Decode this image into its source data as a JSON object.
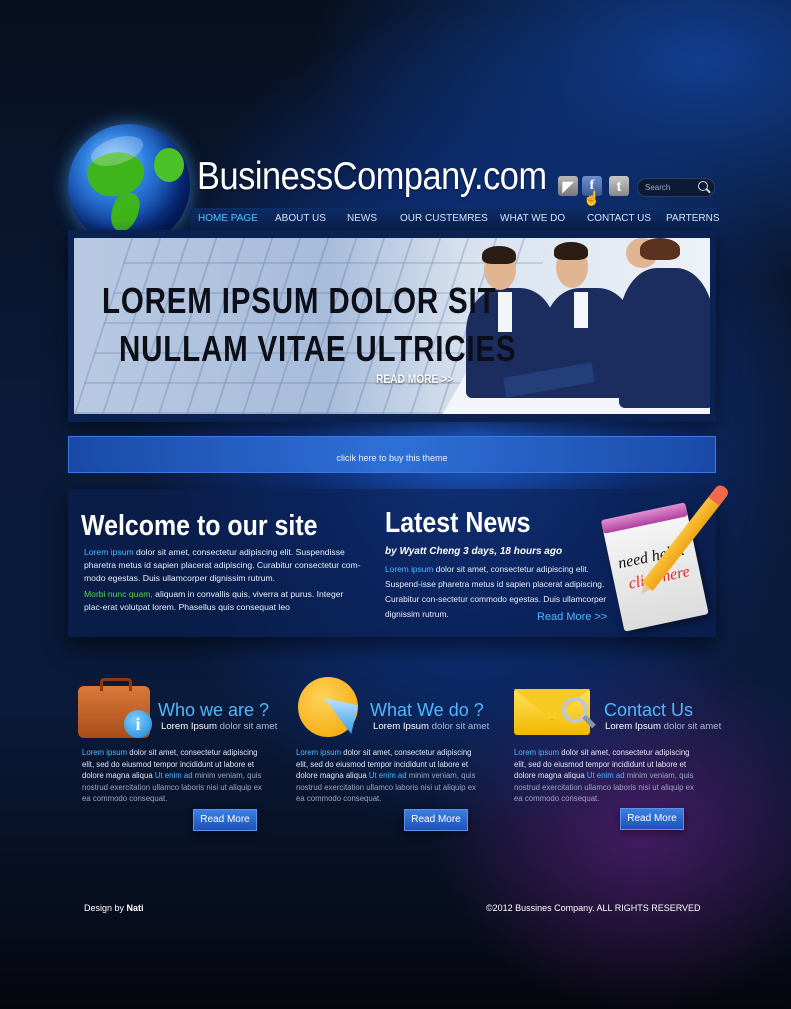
{
  "header": {
    "logo": "BusinessCompany.com",
    "social": {
      "rss": "rss-icon",
      "facebook": "f",
      "twitter": "t"
    },
    "search_placeholder": "Search"
  },
  "nav": [
    "HOME PAGE",
    "ABOUT US",
    "NEWS",
    "OUR CUSTEMRES",
    "WHAT WE DO",
    "CONTACT US",
    "PARTERNS"
  ],
  "banner": {
    "line1": "LOREM IPSUM DOLOR SIT",
    "line2": "NULLAM VITAE ULTRICIES",
    "read_more": "READ MORE >>"
  },
  "buybar": "clicik here to buy this theme",
  "welcome": {
    "title": "Welcome to our site",
    "p1_highlight": "Lorem ipsum",
    "p1_text": " dolor sit amet, consectetur adipiscing elit. Suspendisse pharetra metus id sapien placerat adipiscing. Curabitur consectetur com-modo egestas. Duis ullamcorper dignissim rutrum.",
    "p2_highlight": "Morbi nunc quam,",
    "p2_text": " aliquam in convallis quis, viverra at purus. Integer plac-erat volutpat lorem. Phasellus quis consequat leo"
  },
  "news": {
    "title": "Latest News",
    "byline": "by Wyatt Cheng 3 days, 18 hours ago",
    "highlight": "Lorem ipsum",
    "text": " dolor sit amet, consectetur adipiscing elit. Suspend-isse pharetra metus id sapien placerat adipiscing. Curabitur con-sectetur commodo egestas. Duis ullamcorper dignissim rutrum.",
    "more": "Read More >>"
  },
  "help_note": {
    "line1": "need help?",
    "line2": "click here"
  },
  "features": [
    {
      "title": "Who we are ?",
      "sub_a": "Lorem Ipsum",
      "sub_b": " dolor sit amet",
      "hl1": "Lorem ipsum",
      "t1": " dolor sit amet, consectetur adipiscing elit, sed do eiusmod tempor incididunt ut labore et dolore magna aliqua  ",
      "hl2": "Ut enim ad",
      "t2": " minim veniam, quis nostrud exercitation ullamco laboris nisi ut aliquip ex ea commodo consequat.",
      "button": "Read More"
    },
    {
      "title": "What We do ?",
      "sub_a": "Lorem Ipsum",
      "sub_b": " dolor sit amet",
      "hl1": "Lorem ipsum",
      "t1": " dolor sit amet, consectetur adipiscing elit, sed do eiusmod tempor incididunt ut labore et dolore magna aliqua  ",
      "hl2": "Ut enim ad",
      "t2": " minim veniam, quis nostrud exercitation ullamco laboris nisi ut aliquip ex ea commodo consequat.",
      "button": "Read More"
    },
    {
      "title": "Contact Us",
      "sub_a": "Lorem Ipsum",
      "sub_b": " dolor sit amet",
      "hl1": "Lorem ipsum",
      "t1": " dolor sit amet, consectetur adipiscing elit, sed do eiusmod tempor incididunt ut labore et dolore magna aliqua  ",
      "hl2": "Ut enim ad",
      "t2": " minim veniam, quis nostrud exercitation ullamco laboris nisi ut aliquip ex ea commodo consequat.",
      "button": "Read More"
    }
  ],
  "footer": {
    "design_by": "Design by ",
    "designer": "Nati",
    "copyright": "©2012 Bussines Company. ALL RIGHTS RESERVED"
  },
  "colors": {
    "accent": "#4fb8ff",
    "highlight_green": "#5ad24b",
    "nav_bg": "#0e2c66"
  }
}
